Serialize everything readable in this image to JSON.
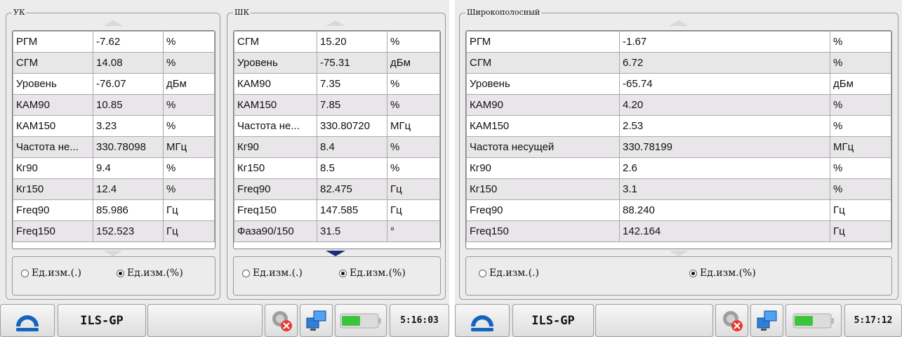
{
  "radio_labels": {
    "units_plain": "Ед.изм.(.)",
    "units_percent": "Ед.изм.(%)"
  },
  "left": {
    "groups": [
      {
        "title": "УК",
        "rows": [
          [
            "РГМ",
            "-7.62",
            "%"
          ],
          [
            "СГМ",
            "14.08",
            "%"
          ],
          [
            "Уровень",
            "-76.07",
            "дБм"
          ],
          [
            "КАМ90",
            "10.85",
            "%"
          ],
          [
            "КАМ150",
            "3.23",
            "%"
          ],
          [
            "Частота не...",
            "330.78098",
            "МГц"
          ],
          [
            "Кг90",
            "9.4",
            "%"
          ],
          [
            "Кг150",
            "12.4",
            "%"
          ],
          [
            "Freq90",
            "85.986",
            "Гц"
          ],
          [
            "Freq150",
            "152.523",
            "Гц"
          ]
        ]
      },
      {
        "title": "ШК",
        "rows": [
          [
            "СГМ",
            "15.20",
            "%"
          ],
          [
            "Уровень",
            "-75.31",
            "дБм"
          ],
          [
            "КАМ90",
            "7.35",
            "%"
          ],
          [
            "КАМ150",
            "7.85",
            "%"
          ],
          [
            "Частота не...",
            "330.80720",
            "МГц"
          ],
          [
            "Кг90",
            "8.4",
            "%"
          ],
          [
            "Кг150",
            "8.5",
            "%"
          ],
          [
            "Freq90",
            "82.475",
            "Гц"
          ],
          [
            "Freq150",
            "147.585",
            "Гц"
          ],
          [
            "Фаза90/150",
            "31.5",
            "°"
          ]
        ]
      }
    ],
    "taskbar": {
      "title": "ILS-GP",
      "clock": "5:16:03"
    }
  },
  "right": {
    "group": {
      "title": "Широкополосный",
      "rows": [
        [
          "РГМ",
          "-1.67",
          "%"
        ],
        [
          "СГМ",
          "6.72",
          "%"
        ],
        [
          "Уровень",
          "-65.74",
          "дБм"
        ],
        [
          "КАМ90",
          "4.20",
          "%"
        ],
        [
          "КАМ150",
          "2.53",
          "%"
        ],
        [
          "Частота несущей",
          "330.78199",
          "МГц"
        ],
        [
          "Кг90",
          "2.6",
          "%"
        ],
        [
          "Кг150",
          "3.1",
          "%"
        ],
        [
          "Freq90",
          "88.240",
          "Гц"
        ],
        [
          "Freq150",
          "142.164",
          "Гц"
        ]
      ]
    },
    "taskbar": {
      "title": "ILS-GP",
      "clock": "5:17:12"
    }
  },
  "colors": {
    "row_alt": "#e9e6e9",
    "logo_blue": "#1565c0",
    "battery_green": "#3cc43c",
    "error_red": "#e53935"
  },
  "icons": [
    "app-logo-icon",
    "network-error-icon",
    "network-monitors-icon",
    "battery-icon"
  ]
}
